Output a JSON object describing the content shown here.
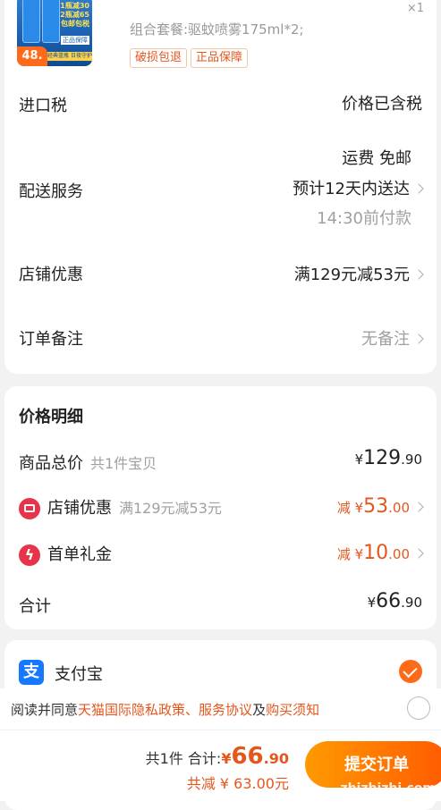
{
  "product": {
    "combo": "组合套餐:驱蚊喷雾175ml*2;",
    "qty": "×1",
    "badges": [
      "破损包退",
      "正品保障"
    ],
    "img_promo_1": "1瓶减30",
    "img_promo_2": "2瓶减65",
    "img_promo_3": "包邮包税",
    "img_tag": "正品保障",
    "img_price": "48.",
    "img_band": "经典蓝瓶 日夜守护"
  },
  "order": {
    "tax_label": "进口税",
    "tax_value": "价格已含税",
    "shipping_label": "配送服务",
    "shipping_fee": "运费 免邮",
    "shipping_eta": "预计12天内送达",
    "shipping_deadline": "14:30前付款",
    "shop_discount_label": "店铺优惠",
    "shop_discount_value": "满129元减53元",
    "note_label": "订单备注",
    "note_value": "无备注"
  },
  "price": {
    "title": "价格明细",
    "goods_label": "商品总价",
    "goods_sub": "共1件宝贝",
    "goods_yuan": "¥",
    "goods_int": "129",
    "goods_dec": ".90",
    "shop_label": "店铺优惠",
    "shop_sub": "满129元减53元",
    "shop_prefix": "减 ¥",
    "shop_int": "53",
    "shop_dec": ".00",
    "gift_label": "首单礼金",
    "gift_prefix": "减 ¥",
    "gift_int": "10",
    "gift_dec": ".00",
    "total_label": "合计",
    "total_yuan": "¥",
    "total_int": "66",
    "total_dec": ".90"
  },
  "payment": {
    "method_icon": "支",
    "method_label": "支付宝"
  },
  "agreement": {
    "prefix": "阅读并同意",
    "link1": "天猫国际隐私政策",
    "sep": "、",
    "link2": "服务协议",
    "and": "及",
    "link3": "购买须知"
  },
  "bottom": {
    "count": "共1件",
    "total_label": "合计:",
    "total_prefix": "¥",
    "total_int": "66",
    "total_dec": ".90",
    "saved": "共减 ¥ 63.00元",
    "submit": "提交订单",
    "watermark": "zhizhizhi.com"
  },
  "colors": {
    "accent": "#e4571c",
    "alipay": "#1677ff",
    "button_start": "#ff9a00",
    "button_end": "#ff5a00"
  }
}
